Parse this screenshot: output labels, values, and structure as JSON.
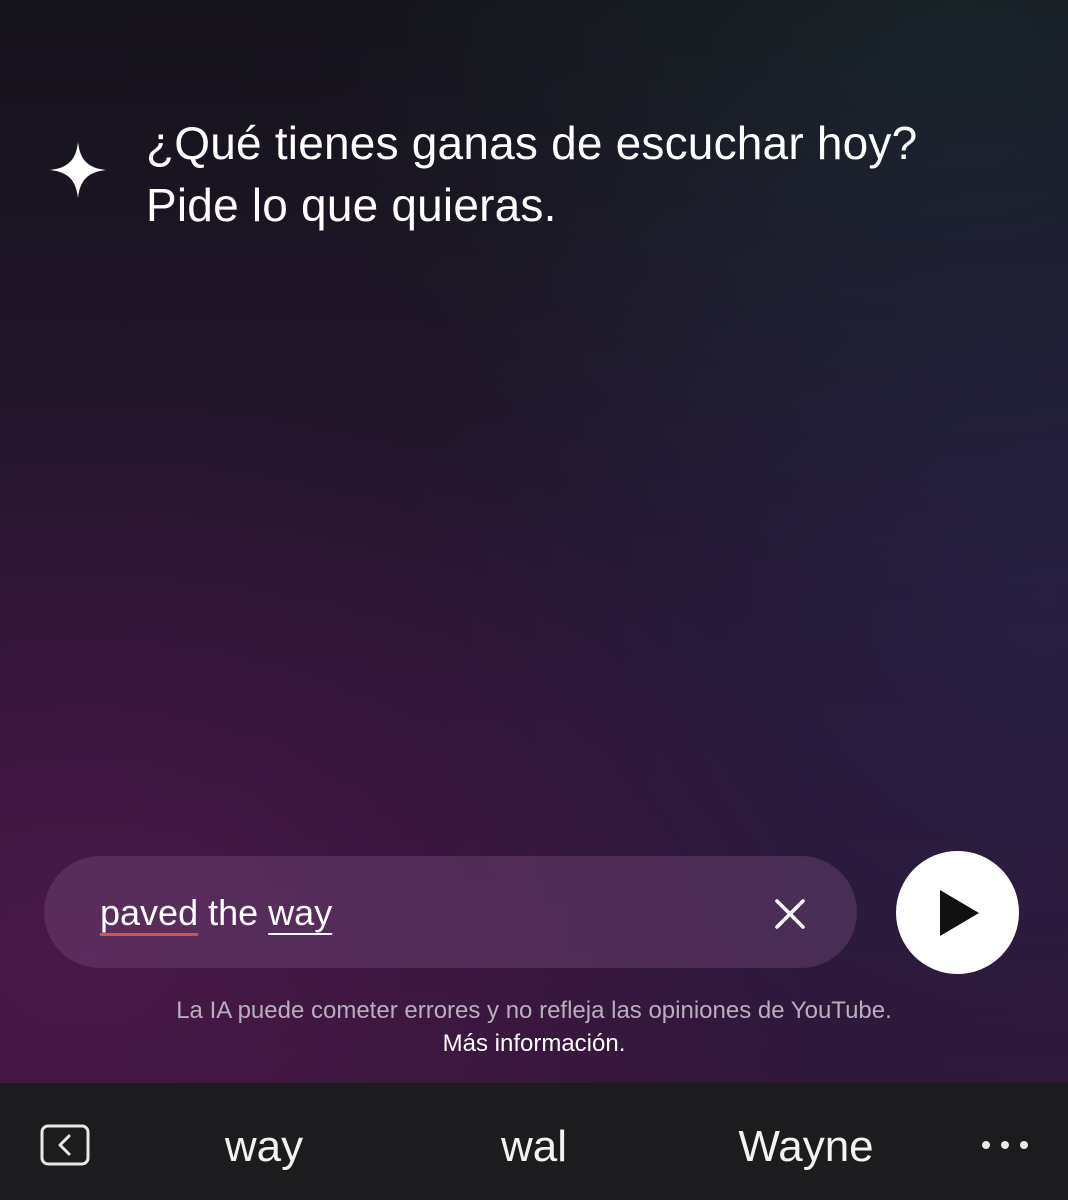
{
  "assistant": {
    "icon": "sparkle-icon",
    "prompt_line1": "¿Qué tienes ganas de escuchar hoy?",
    "prompt_line2": "Pide lo que quieras."
  },
  "input": {
    "words": [
      "paved",
      "the",
      "way"
    ],
    "value": "paved the way",
    "clear_icon": "close-icon"
  },
  "send_button": {
    "icon": "play-icon",
    "color": "#ffffff"
  },
  "disclaimer": {
    "text": "La IA puede cometer errores y no refleja las opiniones de YouTube.",
    "link": "Más información",
    "link_suffix": "."
  },
  "keyboard": {
    "back_icon": "chevron-left-icon",
    "suggestions": [
      "way",
      "wal",
      "Wayne"
    ],
    "more_icon": "more-horizontal-icon"
  },
  "colors": {
    "spellcheck_underline": "#e0503a",
    "keyboard_bar": "#1c1b1d"
  }
}
